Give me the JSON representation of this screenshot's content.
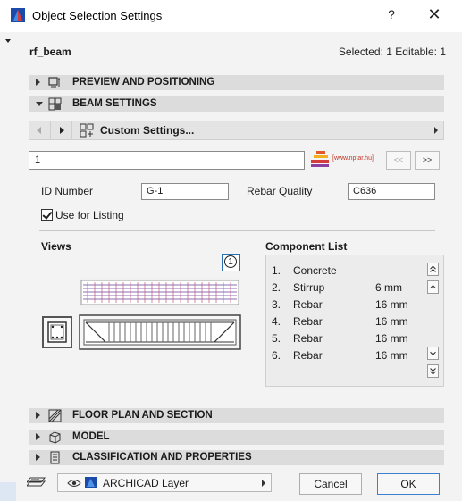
{
  "dialog": {
    "title": "Object Selection Settings",
    "help": "?",
    "close": "✕"
  },
  "header": {
    "object_name": "rf_beam",
    "selection_info": "Selected: 1 Editable: 1"
  },
  "panels": {
    "preview": "PREVIEW AND POSITIONING",
    "beam": "BEAM SETTINGS",
    "floor_plan": "FLOOR PLAN AND SECTION",
    "model": "MODEL",
    "classification": "CLASSIFICATION AND PROPERTIES"
  },
  "navbar": {
    "custom_settings": "Custom Settings..."
  },
  "search": {
    "value": "1"
  },
  "logo": {
    "url": "[www.nptar.hu]"
  },
  "pager": {
    "prev": "<<",
    "next": ">>"
  },
  "form": {
    "id_label": "ID Number",
    "id_value": "G-1",
    "rebar_label": "Rebar Quality",
    "rebar_value": "C636",
    "listing_label": "Use for Listing",
    "listing_checked": true
  },
  "views": {
    "title": "Views",
    "badge": "1"
  },
  "components": {
    "title": "Component List",
    "items": [
      {
        "n": "1.",
        "material": "Concrete",
        "size": ""
      },
      {
        "n": "2.",
        "material": "Stirrup",
        "size": "6 mm"
      },
      {
        "n": "3.",
        "material": "Rebar",
        "size": "16 mm"
      },
      {
        "n": "4.",
        "material": "Rebar",
        "size": "16 mm"
      },
      {
        "n": "5.",
        "material": "Rebar",
        "size": "16 mm"
      },
      {
        "n": "6.",
        "material": "Rebar",
        "size": "16 mm"
      }
    ]
  },
  "footer": {
    "layer": "ARCHICAD Layer",
    "cancel": "Cancel",
    "ok": "OK"
  },
  "colors": {
    "accent": "#3c7fd1",
    "panel": "#dcdcdc",
    "archicad_blue": "#1c4aa8"
  }
}
